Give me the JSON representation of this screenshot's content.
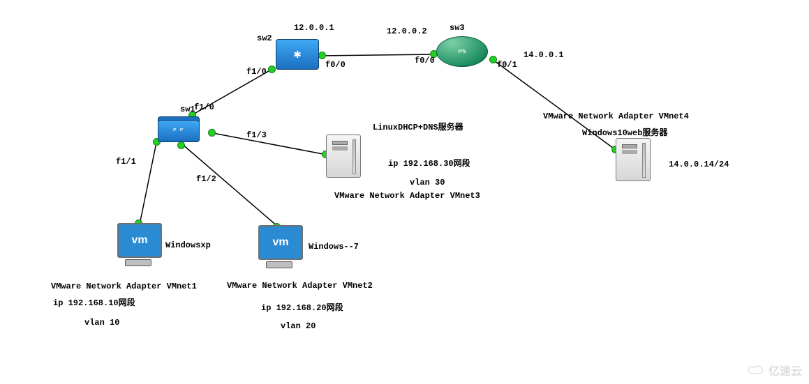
{
  "devices": {
    "sw1": {
      "label": "sw1",
      "type": "switch"
    },
    "sw2": {
      "label": "sw2",
      "type": "l3switch"
    },
    "sw3": {
      "label": "sw3",
      "type": "router"
    },
    "winxp": {
      "label": "Windowsxp",
      "type": "monitor",
      "badge": "vm"
    },
    "win7": {
      "label": "Windows--7",
      "type": "monitor",
      "badge": "vm"
    },
    "linuxsrv": {
      "label": "LinuxDHCP+DNS服务器",
      "type": "server"
    },
    "websrv": {
      "label_top": "VMware Network Adapter VMnet4",
      "label_mid": "Windows10web服务器",
      "type": "server"
    }
  },
  "ip_labels": {
    "sw2_left_ip": "12.0.0.1",
    "sw2_right_ip": "12.0.0.2",
    "sw3_right_ip": "14.0.0.1",
    "websrv_ip": "14.0.0.14/24",
    "linuxsrv_ip": "ip 192.168.30网段",
    "linuxsrv_vlan": "vlan 30",
    "linuxsrv_adapter": "VMware Network Adapter VMnet3",
    "winxp_adapter": "VMware Network Adapter VMnet1",
    "winxp_ip": "ip 192.168.10网段",
    "winxp_vlan": "vlan 10",
    "win7_adapter": "VMware Network Adapter VMnet2",
    "win7_ip": "ip 192.168.20网段",
    "win7_vlan": "vlan 20"
  },
  "ports": {
    "sw1_to_sw2": "f1/0",
    "sw2_to_sw1": "f1/0",
    "sw2_to_sw3": "f0/0",
    "sw3_to_sw2": "f0/0",
    "sw3_to_web": "f0/1",
    "sw1_to_winxp": "f1/1",
    "sw1_to_win7": "f1/2",
    "sw1_to_linux": "f1/3"
  },
  "chart_data": {
    "type": "diagram",
    "nodes": [
      {
        "id": "sw1",
        "kind": "l2-switch",
        "label": "sw1"
      },
      {
        "id": "sw2",
        "kind": "l3-switch",
        "label": "sw2"
      },
      {
        "id": "sw3",
        "kind": "router",
        "label": "sw3"
      },
      {
        "id": "winxp",
        "kind": "host",
        "label": "Windowsxp",
        "adapter": "VMware Network Adapter VMnet1",
        "ip_segment": "192.168.10",
        "vlan": 10
      },
      {
        "id": "win7",
        "kind": "host",
        "label": "Windows--7",
        "adapter": "VMware Network Adapter VMnet2",
        "ip_segment": "192.168.20",
        "vlan": 20
      },
      {
        "id": "linuxsrv",
        "kind": "server",
        "label": "LinuxDHCP+DNS服务器",
        "adapter": "VMware Network Adapter VMnet3",
        "ip_segment": "192.168.30",
        "vlan": 30
      },
      {
        "id": "websrv",
        "kind": "server",
        "label": "Windows10web服务器",
        "adapter": "VMware Network Adapter VMnet4",
        "ip": "14.0.0.14/24"
      }
    ],
    "edges": [
      {
        "from": "sw1",
        "from_port": "f1/1",
        "to": "winxp"
      },
      {
        "from": "sw1",
        "from_port": "f1/2",
        "to": "win7"
      },
      {
        "from": "sw1",
        "from_port": "f1/3",
        "to": "linuxsrv"
      },
      {
        "from": "sw1",
        "from_port": "f1/0",
        "to": "sw2",
        "to_port": "f1/0"
      },
      {
        "from": "sw2",
        "from_port": "f0/0",
        "from_ip": "12.0.0.1",
        "to": "sw3",
        "to_port": "f0/0",
        "to_ip": "12.0.0.2"
      },
      {
        "from": "sw3",
        "from_port": "f0/1",
        "from_ip": "14.0.0.1",
        "to": "websrv"
      }
    ]
  },
  "watermark": "亿速云"
}
